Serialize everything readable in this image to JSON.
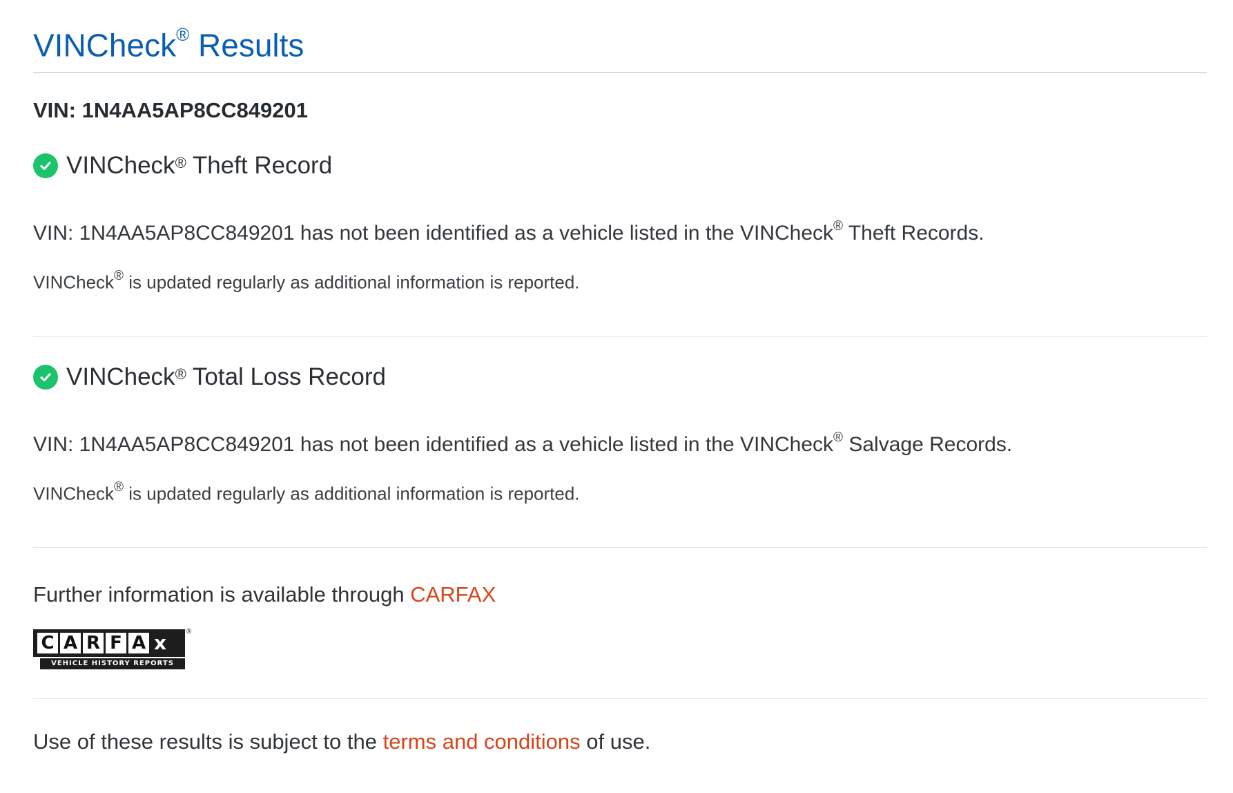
{
  "header": {
    "title_text": "VINCheck",
    "title_reg": "®",
    "title_suffix": " Results"
  },
  "vin_line": "VIN: 1N4AA5AP8CC849201",
  "sections": [
    {
      "heading_prefix": "VINCheck",
      "heading_reg": "®",
      "heading_suffix": " Theft Record",
      "status_icon": "check-circle-icon",
      "status_color": "#1bc46a",
      "body_prefix": "VIN: 1N4AA5AP8CC849201 has not been identified as a vehicle listed in the VINCheck",
      "body_reg": "®",
      "body_suffix": " Theft Records.",
      "note_prefix": "VINCheck",
      "note_reg": "®",
      "note_suffix": " is updated regularly as additional information is reported."
    },
    {
      "heading_prefix": "VINCheck",
      "heading_reg": "®",
      "heading_suffix": " Total Loss Record",
      "status_icon": "check-circle-icon",
      "status_color": "#1bc46a",
      "body_prefix": "VIN: 1N4AA5AP8CC849201 has not been identified as a vehicle listed in the VINCheck",
      "body_reg": "®",
      "body_suffix": " Salvage Records.",
      "note_prefix": "VINCheck",
      "note_reg": "®",
      "note_suffix": " is updated regularly as additional information is reported."
    }
  ],
  "further_info": {
    "text": "Further information is available through ",
    "link_text": "CARFAX"
  },
  "carfax_logo": {
    "letters": [
      "C",
      "A",
      "R",
      "F",
      "A"
    ],
    "x_mark": "x",
    "reg": "®",
    "tagline": "VEHICLE HISTORY REPORTS"
  },
  "terms": {
    "prefix": "Use of these results is subject to the ",
    "link_text": "terms and conditions",
    "suffix": " of use."
  },
  "colors": {
    "title": "#0a5fb2",
    "link": "#d8431a",
    "success": "#1bc46a"
  }
}
